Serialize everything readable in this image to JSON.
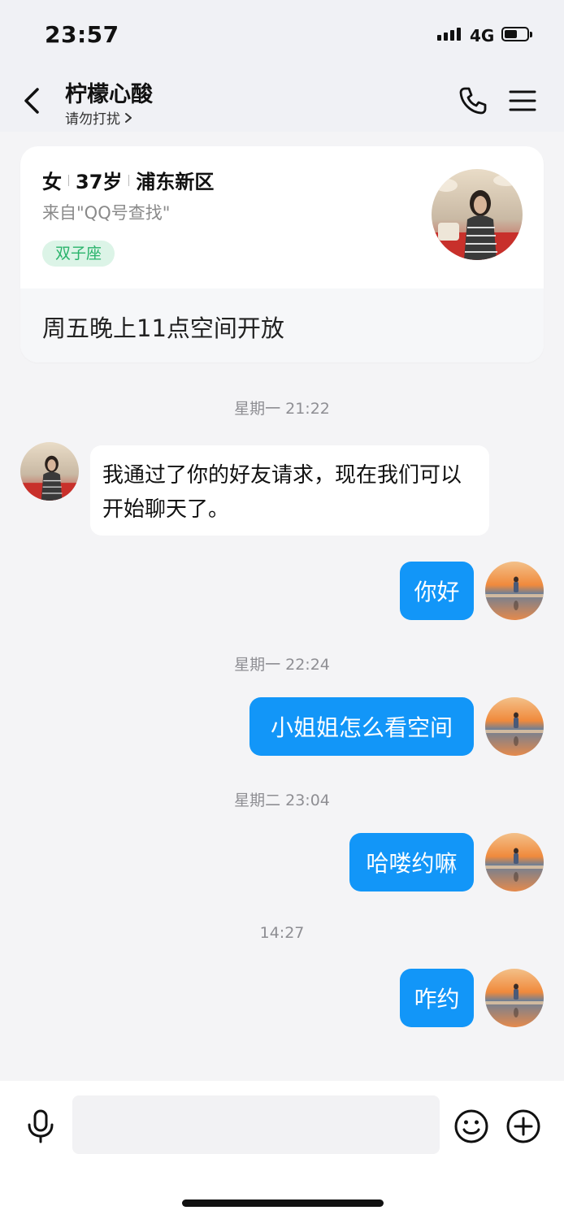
{
  "status_bar": {
    "time": "23:57",
    "network": "4G",
    "battery_level": 0.5
  },
  "header": {
    "title": "柠檬心酸",
    "subtitle": "请勿打扰"
  },
  "profile_card": {
    "gender": "女",
    "age": "37岁",
    "location": "浦东新区",
    "source": "来自\"QQ号查找\"",
    "tag": "双子座",
    "signature": "周五晚上11点空间开放"
  },
  "messages": [
    {
      "type": "time",
      "text": "星期一 21:22"
    },
    {
      "type": "received",
      "text": "我通过了你的好友请求，现在我们可以开始聊天了。"
    },
    {
      "type": "sent",
      "text": "你好"
    },
    {
      "type": "time",
      "text": "星期一 22:24"
    },
    {
      "type": "sent",
      "text": "小姐姐怎么看空间"
    },
    {
      "type": "time",
      "text": "星期二 23:04"
    },
    {
      "type": "sent",
      "text": "哈喽约嘛"
    },
    {
      "type": "time",
      "text": "14:27"
    },
    {
      "type": "sent",
      "text": "咋约"
    }
  ],
  "input": {
    "placeholder": ""
  },
  "colors": {
    "sent_bubble": "#1296f8",
    "tag_bg": "#dcf4e7",
    "tag_text": "#29b36b",
    "background": "#f4f4f6"
  },
  "icons": [
    "back-icon",
    "chevron-right-icon",
    "phone-icon",
    "menu-icon",
    "microphone-icon",
    "emoji-icon",
    "plus-icon"
  ]
}
